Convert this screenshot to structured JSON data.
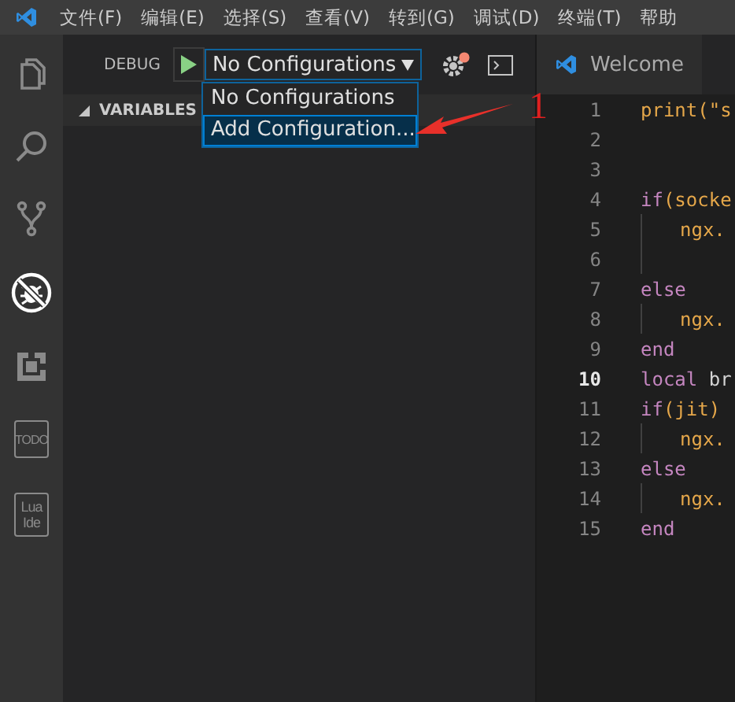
{
  "menu_bar": {
    "items": [
      "文件(F)",
      "编辑(E)",
      "选择(S)",
      "查看(V)",
      "转到(G)",
      "调试(D)",
      "终端(T)",
      "帮助"
    ]
  },
  "activity_bar": [
    {
      "kind": "files",
      "selected": false
    },
    {
      "kind": "search",
      "selected": false
    },
    {
      "kind": "branch",
      "selected": false
    },
    {
      "kind": "debug",
      "selected": true
    },
    {
      "kind": "extensions",
      "selected": false
    },
    {
      "kind": "badge",
      "label": "TODO",
      "selected": false
    },
    {
      "kind": "badge",
      "label": "Lua Ide",
      "selected": false
    }
  ],
  "debug_toolbar": {
    "label": "DEBUG",
    "configuration": "No Configurations",
    "settings_alert": true
  },
  "configuration_menu": [
    {
      "label": "No Configurations",
      "selected": false
    },
    {
      "label": "Add Configuration...",
      "selected": true
    }
  ],
  "sidebar_sections": [
    {
      "title": "VARIABLES",
      "expanded": true
    }
  ],
  "tabs": [
    {
      "label": "Welcome",
      "selected": true
    }
  ],
  "annotation": {
    "label": "1"
  },
  "code_lines": [
    {
      "number": "1",
      "current": false,
      "indented": false,
      "tokens": [
        {
          "kind": "name",
          "text": "print(\"s"
        }
      ]
    },
    {
      "number": "2",
      "current": false,
      "indented": false
    },
    {
      "number": "3",
      "current": false,
      "indented": false
    },
    {
      "number": "4",
      "current": false,
      "indented": false,
      "tokens": [
        {
          "kind": "keyword",
          "text": "if"
        },
        {
          "kind": "name",
          "text": "(socke"
        }
      ]
    },
    {
      "number": "5",
      "current": false,
      "indented": true,
      "tokens": [
        {
          "kind": "name",
          "text": "ngx."
        }
      ]
    },
    {
      "number": "6",
      "current": false,
      "indented": true
    },
    {
      "number": "7",
      "current": false,
      "indented": false,
      "tokens": [
        {
          "kind": "keyword",
          "text": "else"
        }
      ]
    },
    {
      "number": "8",
      "current": false,
      "indented": true,
      "tokens": [
        {
          "kind": "name",
          "text": "ngx."
        }
      ]
    },
    {
      "number": "9",
      "current": false,
      "indented": false,
      "tokens": [
        {
          "kind": "keyword",
          "text": "end"
        }
      ]
    },
    {
      "number": "10",
      "current": true,
      "indented": false,
      "tokens": [
        {
          "kind": "keyword",
          "text": "local"
        },
        {
          "kind": "plain",
          "text": " br"
        }
      ]
    },
    {
      "number": "11",
      "current": false,
      "indented": false,
      "tokens": [
        {
          "kind": "keyword",
          "text": "if"
        },
        {
          "kind": "name",
          "text": "(jit)"
        }
      ]
    },
    {
      "number": "12",
      "current": false,
      "indented": true,
      "tokens": [
        {
          "kind": "name",
          "text": "ngx."
        }
      ]
    },
    {
      "number": "13",
      "current": false,
      "indented": false,
      "tokens": [
        {
          "kind": "keyword",
          "text": "else"
        }
      ]
    },
    {
      "number": "14",
      "current": false,
      "indented": true,
      "tokens": [
        {
          "kind": "name",
          "text": "ngx."
        }
      ]
    },
    {
      "number": "15",
      "current": false,
      "indented": false,
      "tokens": [
        {
          "kind": "keyword",
          "text": "end"
        }
      ]
    }
  ]
}
